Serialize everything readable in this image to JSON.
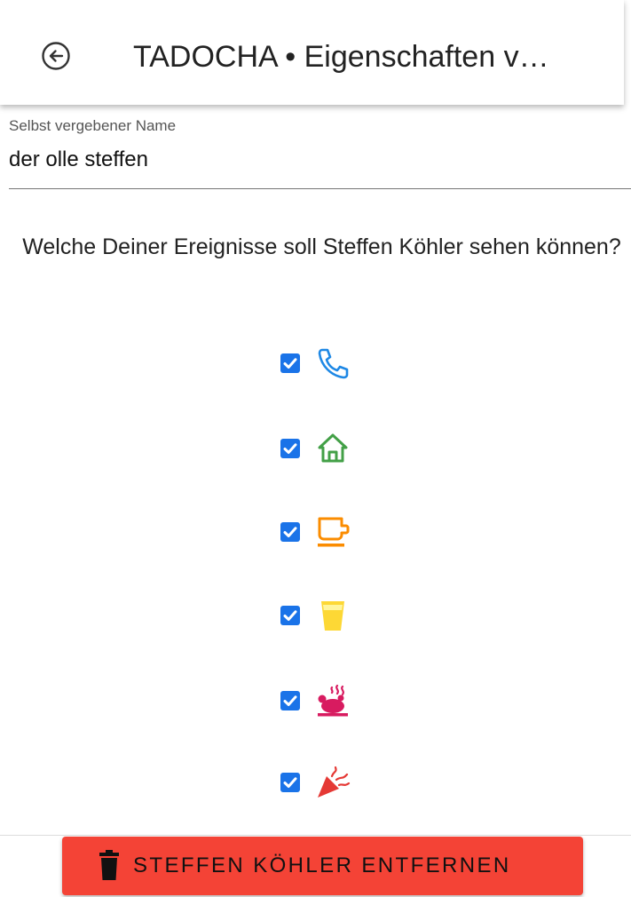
{
  "appbar": {
    "title": "TADOCHA • Eigenschaften v…",
    "back_icon": "arrow-left-circle-icon"
  },
  "name_field": {
    "label": "Selbst vergebener Name",
    "value": "der olle steffen"
  },
  "question": "Welche Deiner Ereignisse soll Steffen Köhler sehen können?",
  "events": [
    {
      "icon": "phone-icon",
      "color": "#1e88e5",
      "checked": true
    },
    {
      "icon": "home-icon",
      "color": "#43a047",
      "checked": true
    },
    {
      "icon": "coffee-cup-icon",
      "color": "#fb8c00",
      "checked": true
    },
    {
      "icon": "glass-icon",
      "color": "#fdd835",
      "checked": true
    },
    {
      "icon": "hot-food-icon",
      "color": "#d81b60",
      "checked": true
    },
    {
      "icon": "party-popper-icon",
      "color": "#e53935",
      "checked": true
    }
  ],
  "delete_button": {
    "label": "STEFFEN KÖHLER ENTFERNEN",
    "icon": "trash-icon",
    "color": "#f44336"
  }
}
